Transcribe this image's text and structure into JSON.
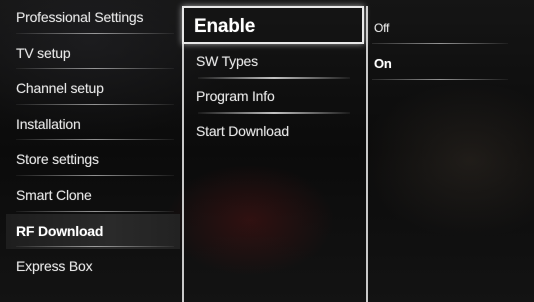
{
  "menu": {
    "level1": [
      {
        "label": "Professional Settings"
      },
      {
        "label": "TV setup"
      },
      {
        "label": "Channel setup"
      },
      {
        "label": "Installation"
      },
      {
        "label": "Store settings"
      },
      {
        "label": "Smart Clone"
      },
      {
        "label": "RF Download"
      },
      {
        "label": "Express Box"
      }
    ],
    "level1_selected": "RF Download",
    "level2": [
      {
        "label": "Enable"
      },
      {
        "label": "SW Types"
      },
      {
        "label": "Program Info"
      },
      {
        "label": "Start Download"
      }
    ],
    "level2_focused": "Enable",
    "level3": [
      {
        "label": "Off"
      },
      {
        "label": "On"
      }
    ],
    "level3_current": "On"
  },
  "colors": {
    "background": "#0b0b0b",
    "text": "#e6e6e6",
    "highlight_border": "#e8e8e8"
  }
}
